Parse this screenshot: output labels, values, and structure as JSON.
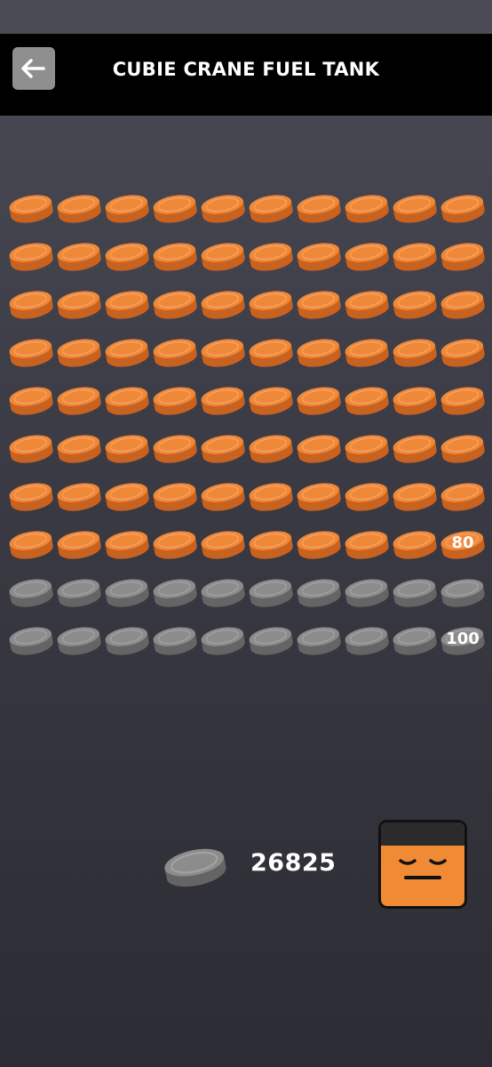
{
  "header": {
    "title": "CUBIE CRANE FUEL TANK",
    "back_icon": "arrow-left-icon"
  },
  "tank": {
    "columns": 10,
    "rows": 10,
    "capacity": 100,
    "filled": 80,
    "row_labels": [
      {
        "row": 7,
        "text": "80"
      },
      {
        "row": 9,
        "text": "100"
      }
    ],
    "colors": {
      "filled_top": "#f0883a",
      "filled_side": "#c8621f",
      "empty_top": "#8c8c8c",
      "empty_side": "#656565"
    }
  },
  "balance": {
    "icon": "fuel-coin-icon",
    "value": "26825"
  },
  "character": {
    "name_icon": "cubie-face-icon",
    "body_color": "#f08a35",
    "hair_color": "#2b2b2b"
  }
}
